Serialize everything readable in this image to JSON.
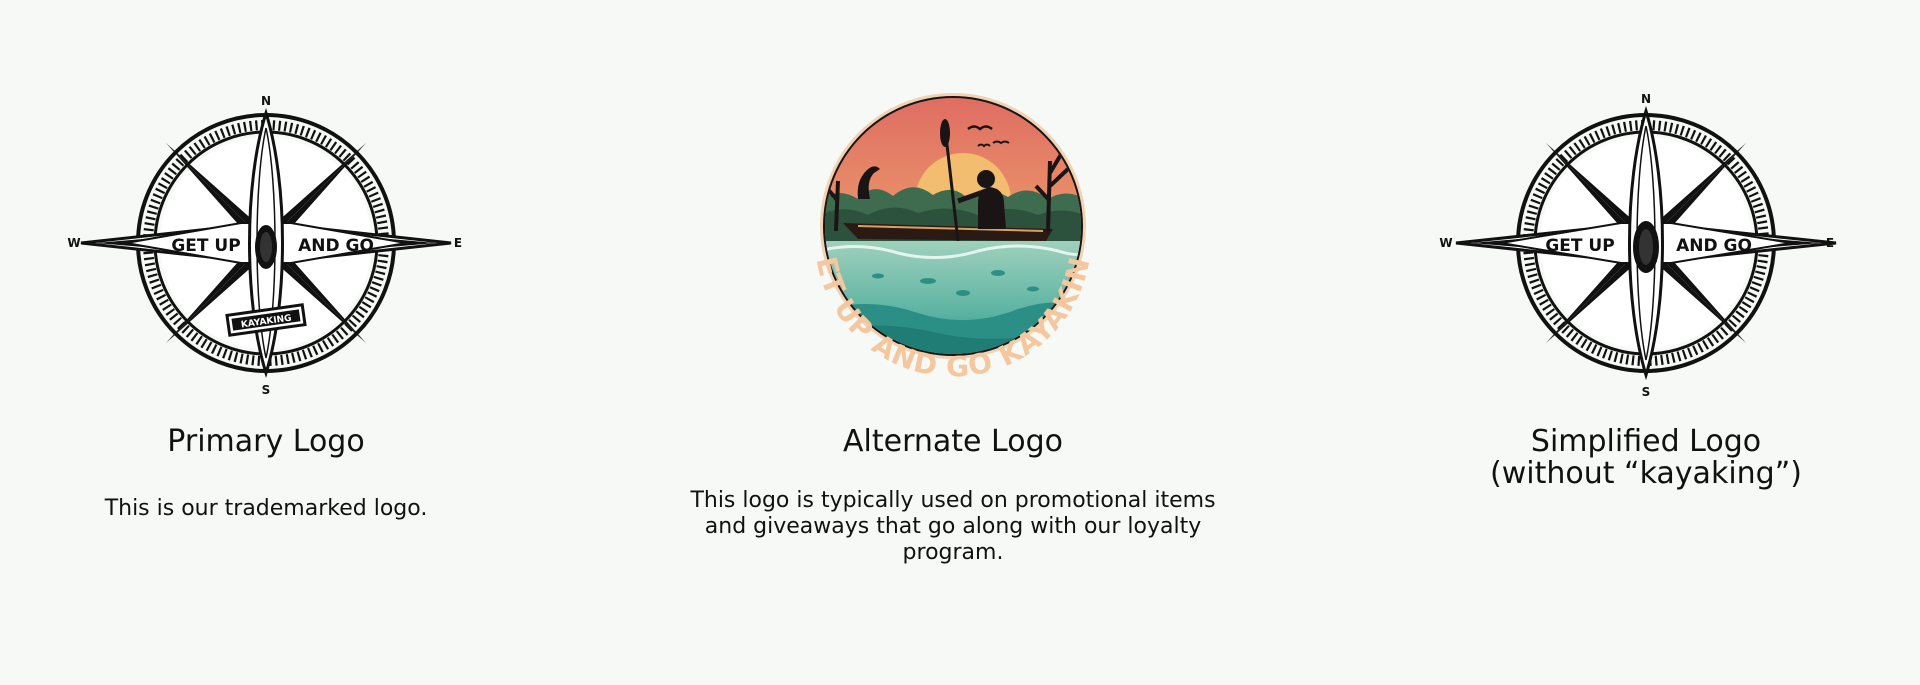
{
  "logos": [
    {
      "name": "Primary Logo",
      "description": "This is our trademarked logo.",
      "compass": {
        "n": "N",
        "s": "S",
        "e": "E",
        "w": "W"
      },
      "badge_left": "GET UP",
      "badge_right": "AND GO",
      "ribbon": "KAYAKING"
    },
    {
      "name": "Alternate Logo",
      "description": "This logo is typically used on promotional items and giveaways that go along with our loyalty program.",
      "arc_text": "GET UP AND GO KAYAKING"
    },
    {
      "name": "Simplified Logo",
      "name_line2": "(without “kayaking”)",
      "compass": {
        "n": "N",
        "s": "S",
        "e": "E",
        "w": "W"
      },
      "badge_left": "GET UP",
      "badge_right": "AND GO"
    }
  ],
  "colors": {
    "background": "#f6f9f6",
    "ink": "#111111",
    "sunset_top": "#de6b62",
    "sunset_mid": "#ec9a6b",
    "sun": "#f2bd6e",
    "water_light": "#8fcab5",
    "water_dark": "#2c8f86",
    "arc_text": "#f4c79f"
  }
}
